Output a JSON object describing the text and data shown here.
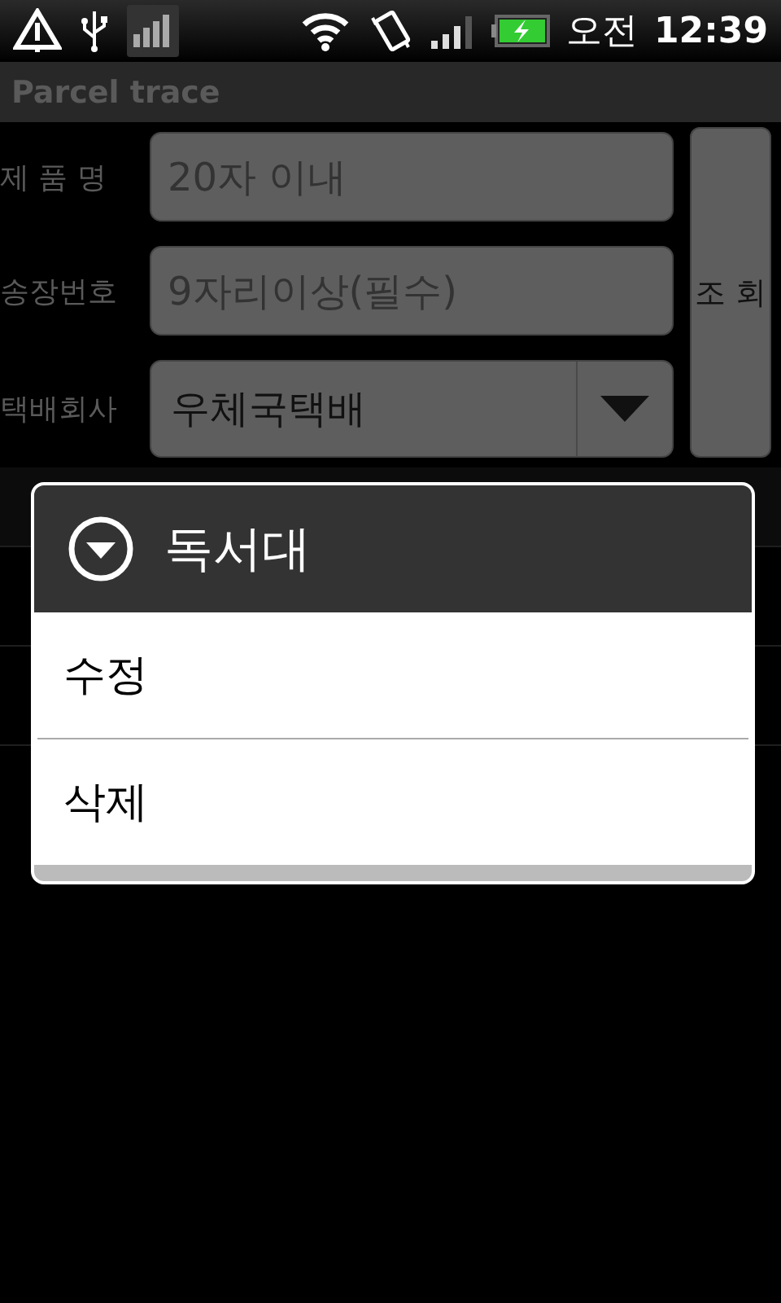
{
  "status_bar": {
    "meridiem": "오전",
    "time": "12:39"
  },
  "title_bar": {
    "title": "Parcel trace"
  },
  "form": {
    "fields": [
      {
        "label": "제 품 명",
        "placeholder": "20자 이내"
      },
      {
        "label": "송장번호",
        "placeholder": "9자리이상(필수)"
      }
    ],
    "courier": {
      "label": "택배회사",
      "value": "우체국택배"
    },
    "search_button": "조 회"
  },
  "dialog": {
    "title": "독서대",
    "items": [
      "수정",
      "삭제"
    ]
  }
}
